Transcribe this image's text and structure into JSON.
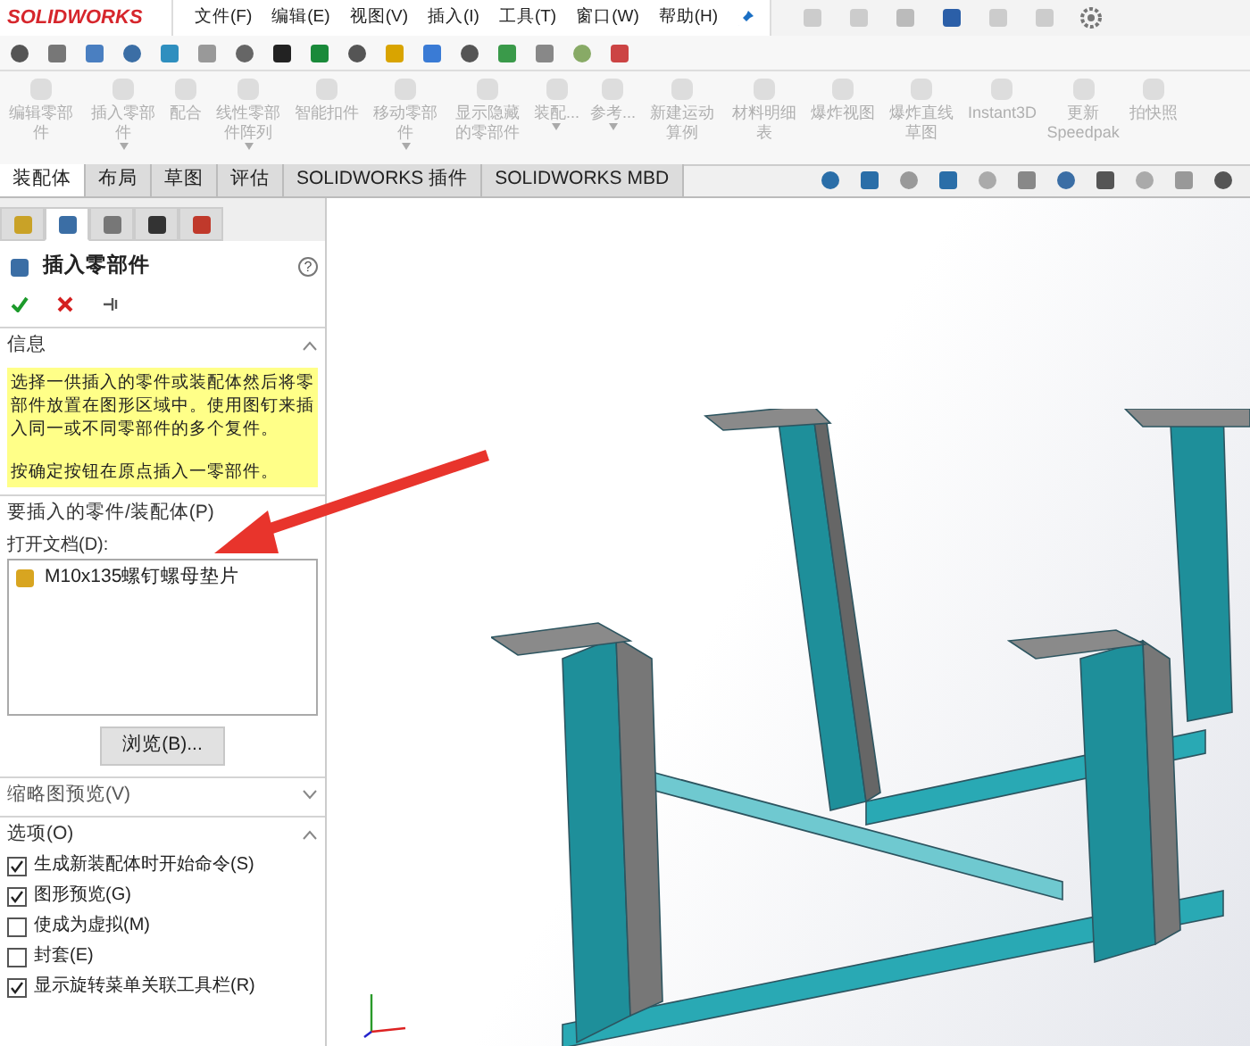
{
  "app": {
    "logo": "SOLIDWORKS"
  },
  "menu": [
    "文件(F)",
    "编辑(E)",
    "视图(V)",
    "插入(I)",
    "工具(T)",
    "窗口(W)",
    "帮助(H)"
  ],
  "commands": [
    {
      "label": "编辑零部件",
      "dropdown": false,
      "disabled": true
    },
    {
      "label": "插入零部件",
      "dropdown": true,
      "disabled": true
    },
    {
      "label": "配合",
      "dropdown": false,
      "disabled": true
    },
    {
      "label": "线性零部件阵列",
      "dropdown": true,
      "disabled": true
    },
    {
      "label": "智能扣件",
      "dropdown": false,
      "disabled": true
    },
    {
      "label": "移动零部件",
      "dropdown": true,
      "disabled": true
    },
    {
      "label": "显示隐藏的零部件",
      "dropdown": false,
      "disabled": true
    },
    {
      "label": "装配...",
      "dropdown": true,
      "disabled": true
    },
    {
      "label": "参考...",
      "dropdown": true,
      "disabled": true
    },
    {
      "label": "新建运动算例",
      "dropdown": false,
      "disabled": true
    },
    {
      "label": "材料明细表",
      "dropdown": false,
      "disabled": true
    },
    {
      "label": "爆炸视图",
      "dropdown": false,
      "disabled": true
    },
    {
      "label": "爆炸直线草图",
      "dropdown": false,
      "disabled": true
    },
    {
      "label": "Instant3D",
      "dropdown": false,
      "disabled": true
    },
    {
      "label": "更新Speedpak",
      "dropdown": false,
      "disabled": true
    },
    {
      "label": "拍快照",
      "dropdown": false,
      "disabled": true
    }
  ],
  "tabs": [
    {
      "label": "装配体",
      "selected": true
    },
    {
      "label": "布局",
      "selected": false
    },
    {
      "label": "草图",
      "selected": false
    },
    {
      "label": "评估",
      "selected": false
    },
    {
      "label": "SOLIDWORKS 插件",
      "selected": false
    },
    {
      "label": "SOLIDWORKS MBD",
      "selected": false
    }
  ],
  "panel_tabs": [
    {
      "selected": false
    },
    {
      "selected": true
    },
    {
      "selected": false
    },
    {
      "selected": false
    },
    {
      "selected": false
    }
  ],
  "panel": {
    "title": "插入零部件",
    "help": "?",
    "sections": [
      {
        "kind": "message",
        "title": "信息",
        "expanded": true,
        "paragraphs": [
          "选择一供插入的零件或装配体然后将零部件放置在图形区域中。使用图钉来插入同一或不同零部件的多个复件。",
          "按确定按钮在原点插入一零部件。"
        ]
      },
      {
        "kind": "documents",
        "title": "要插入的零件/装配体(P)",
        "expanded": true,
        "list_label": "打开文档(D):",
        "documents": [
          "M10x135螺钉螺母垫片"
        ],
        "button": "浏览(B)..."
      },
      {
        "title": "缩略图预览(V)",
        "expanded": false
      },
      {
        "kind": "options",
        "title": "选项(O)",
        "expanded": true,
        "options": [
          {
            "label": "生成新装配体时开始命令(S)",
            "checked": true
          },
          {
            "label": "图形预览(G)",
            "checked": true
          },
          {
            "label": "使成为虚拟(M)",
            "checked": false
          },
          {
            "label": "封套(E)",
            "checked": false
          },
          {
            "label": "显示旋转菜单关联工具栏(R)",
            "checked": true
          }
        ]
      }
    ]
  }
}
